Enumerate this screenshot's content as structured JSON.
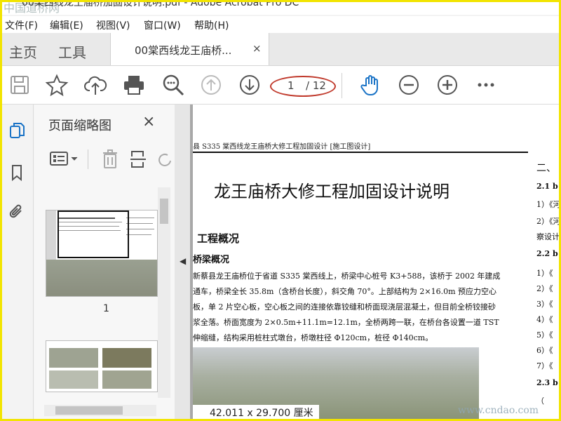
{
  "window": {
    "title": "00棠西线龙王庙桥加固设计说明.pdf - Adobe Acrobat Pro DC",
    "watermark_top": "中国道桥网",
    "watermark_bottom": "www.cndao.com"
  },
  "menu": [
    "文件(F)",
    "编辑(E)",
    "视图(V)",
    "窗口(W)",
    "帮助(H)"
  ],
  "tabs": {
    "home": "主页",
    "tools": "工具",
    "document": "00棠西线龙王庙桥...",
    "close": "×"
  },
  "toolbar": {
    "icons": [
      "save-icon",
      "star-icon",
      "cloud-upload-icon",
      "print-icon",
      "zoom-search-icon",
      "page-up-icon",
      "page-down-icon",
      "hand-icon",
      "zoom-out-icon",
      "zoom-in-icon",
      "more-icon"
    ],
    "current_page": "1",
    "total_pages": "/ 12"
  },
  "thumbnail_panel": {
    "title": "页面缩略图",
    "close": "×",
    "page_label": "1"
  },
  "document": {
    "header": "县 S335 棠西线龙王庙桥大修工程加固设计 [施工图设计]",
    "title": "龙王庙桥大修工程加固设计说明",
    "section": "工程概况",
    "subsection": "桥梁概况",
    "paragraph": "新蔡县龙王庙桥位于省道 S335 棠西线上，桥梁中心桩号 K3+588，该桥于 2002 年建成通车，桥梁全长 35.8m（含桥台长度），斜交角 70°。上部结构为 2×16.0m 预应力空心板，单 2 片空心板，空心板之间的连接依靠铰缝和桥面现浇层混凝土，但目前全桥铰接砂浆全落。桥面宽度为 2×0.5m+11.1m=12.1m，全桥两跨一联，在桥台各设置一道 TST 伸缩缝，结构采用桩柱式墩台，桥墩柱径 Φ120cm，桩径 Φ140cm。",
    "right_col": [
      "二、",
      "2.1 b",
      "1）《河",
      "2）《河",
      "察设计",
      "2.2 b",
      "1）《",
      "2）《",
      "3）《",
      "4）《",
      "5）《",
      "6）《",
      "7）《",
      "2.3 b",
      "（"
    ]
  },
  "status": {
    "page_size": "42.011 x 29.700 厘米"
  }
}
